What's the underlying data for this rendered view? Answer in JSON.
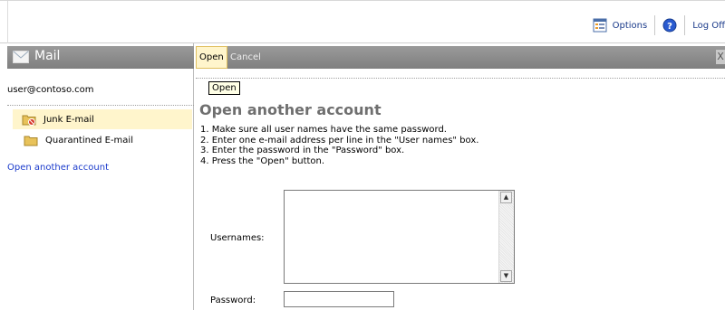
{
  "top": {
    "options_label": "Options",
    "logoff_label": "Log Off"
  },
  "sidebar": {
    "mail_title": "Mail",
    "account": "user@contoso.com",
    "items": [
      {
        "label": "Junk E-mail",
        "selected": true
      },
      {
        "label": "Quarantined E-mail",
        "selected": false
      }
    ],
    "link": "Open another account"
  },
  "toolbar": {
    "open_label": "Open",
    "cancel_label": "Cancel",
    "close_label": "X"
  },
  "tooltip": "Open",
  "main": {
    "heading": "Open another account",
    "instructions": [
      "1. Make sure all user names have the same password.",
      "2. Enter one e-mail address per line in the \"User names\" box.",
      "3. Enter the password in the \"Password\" box.",
      "4. Press the \"Open\" button."
    ],
    "usernames_label": "Usernames:",
    "password_label": "Password:",
    "usernames_value": "",
    "password_value": ""
  },
  "colors": {
    "header_gray": "#8a8a8a",
    "selection": "#fff5cc",
    "link": "#1a3acb",
    "heading": "#6f6f6f"
  }
}
